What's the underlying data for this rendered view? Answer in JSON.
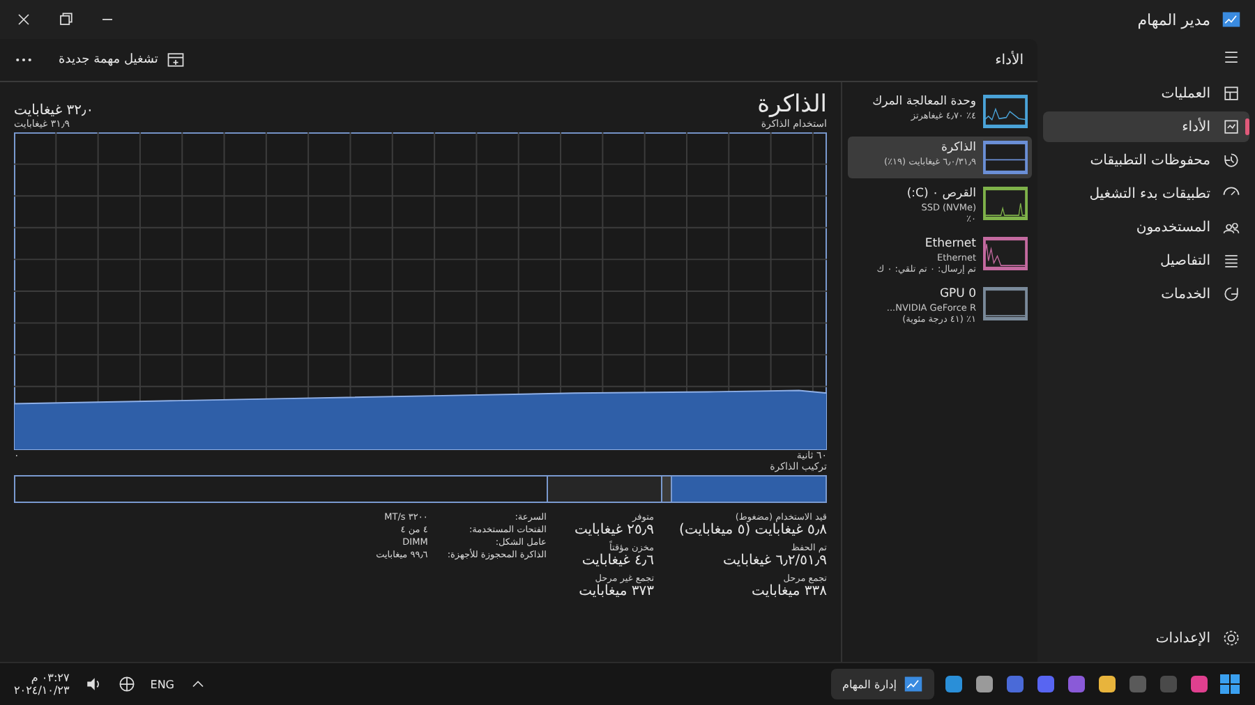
{
  "window": {
    "title": "مدير المهام"
  },
  "toolbar": {
    "header": "الأداء",
    "run_task": "تشغيل مهمة جديدة"
  },
  "nav": {
    "items": [
      {
        "label": "العمليات",
        "selected": false
      },
      {
        "label": "الأداء",
        "selected": true
      },
      {
        "label": "محفوظات التطبيقات",
        "selected": false
      },
      {
        "label": "تطبيقات بدء التشغيل",
        "selected": false
      },
      {
        "label": "المستخدمون",
        "selected": false
      },
      {
        "label": "التفاصيل",
        "selected": false
      },
      {
        "label": "الخدمات",
        "selected": false
      }
    ],
    "settings": "الإعدادات"
  },
  "devices": [
    {
      "name": "وحدة المعالجة المرك",
      "lines": [
        "٤٪ ٤٫٧٠ غيغاهرتز"
      ],
      "selected": false,
      "color": "#4aa3d8"
    },
    {
      "name": "الذاكرة",
      "lines": [
        "٦٫٠/٣١٫٩ غيغابايت (١٩٪)"
      ],
      "selected": true,
      "color": "#6b8fd6"
    },
    {
      "name": "القرص ٠ (C:)",
      "lines": [
        "SSD (NVMe)",
        "٠٪"
      ],
      "selected": false,
      "color": "#7fb24a"
    },
    {
      "name": "Ethernet",
      "lines": [
        "Ethernet",
        "تم إرسال: ٠ تم تلقي: ٠ ك"
      ],
      "selected": false,
      "color": "#c46aa0"
    },
    {
      "name": "GPU 0",
      "lines": [
        "NVIDIA GeForce R...",
        "١٪ (٤١ درجة مئوية)"
      ],
      "selected": false,
      "color": "#7a8a9a"
    }
  ],
  "memory": {
    "title": "الذاكرة",
    "capacity": "٣٢٫٠ غيغابايت",
    "subtitle": "استخدام الذاكرة",
    "max": "٣١٫٩ غيغابايت",
    "time_span": "٦٠ ثانية",
    "zero": "٠",
    "composition": "تركيب الذاكرة",
    "stats": [
      {
        "label": "قيد الاستخدام (مضغوط)",
        "value": "٥٫٨ غيغابايت (٥ ميغابايت)"
      },
      {
        "label": "متوفر",
        "value": "٢٥٫٩ غيغابايت"
      },
      {
        "label": "تم الحفظ",
        "value": "٦٫٢/٥١٫٩ غيغابايت"
      },
      {
        "label": "مخزن مؤقتاً",
        "value": "٤٫٦ غيغابايت"
      },
      {
        "label": "تجمع مرحل",
        "value": "٣٣٨ ميغابايت"
      },
      {
        "label": "تجمع غير مرحل",
        "value": "٣٧٣ ميغابايت"
      }
    ],
    "details": [
      {
        "label": "السرعة:",
        "value": "٣٢٠٠ MT/s"
      },
      {
        "label": "الفتحات المستخدمة:",
        "value": "٤ من ٤"
      },
      {
        "label": "عامل الشكل:",
        "value": "DIMM"
      },
      {
        "label": "الذاكرة المحجوزة للأجهزة:",
        "value": "٩٩٫٦ ميغابايت"
      }
    ]
  },
  "taskbar": {
    "active_app": "إدارة المهام",
    "language": "ENG",
    "time": "٠٣:٢٧ م",
    "date": "٢٠٢٤/١٠/٢٣"
  }
}
